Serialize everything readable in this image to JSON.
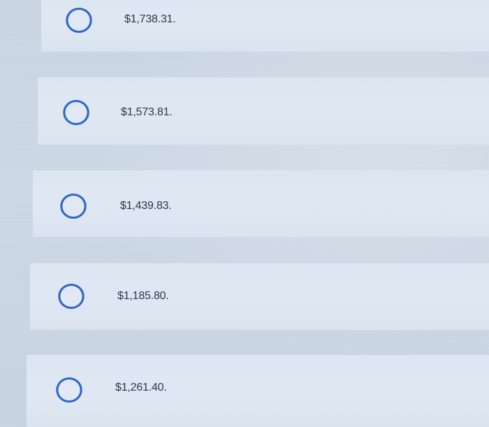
{
  "question": {
    "options": [
      {
        "label": "$1,738.31."
      },
      {
        "label": "$1,573.81."
      },
      {
        "label": "$1,439.83."
      },
      {
        "label": "$1,185.80."
      },
      {
        "label": "$1,261.40."
      }
    ]
  }
}
